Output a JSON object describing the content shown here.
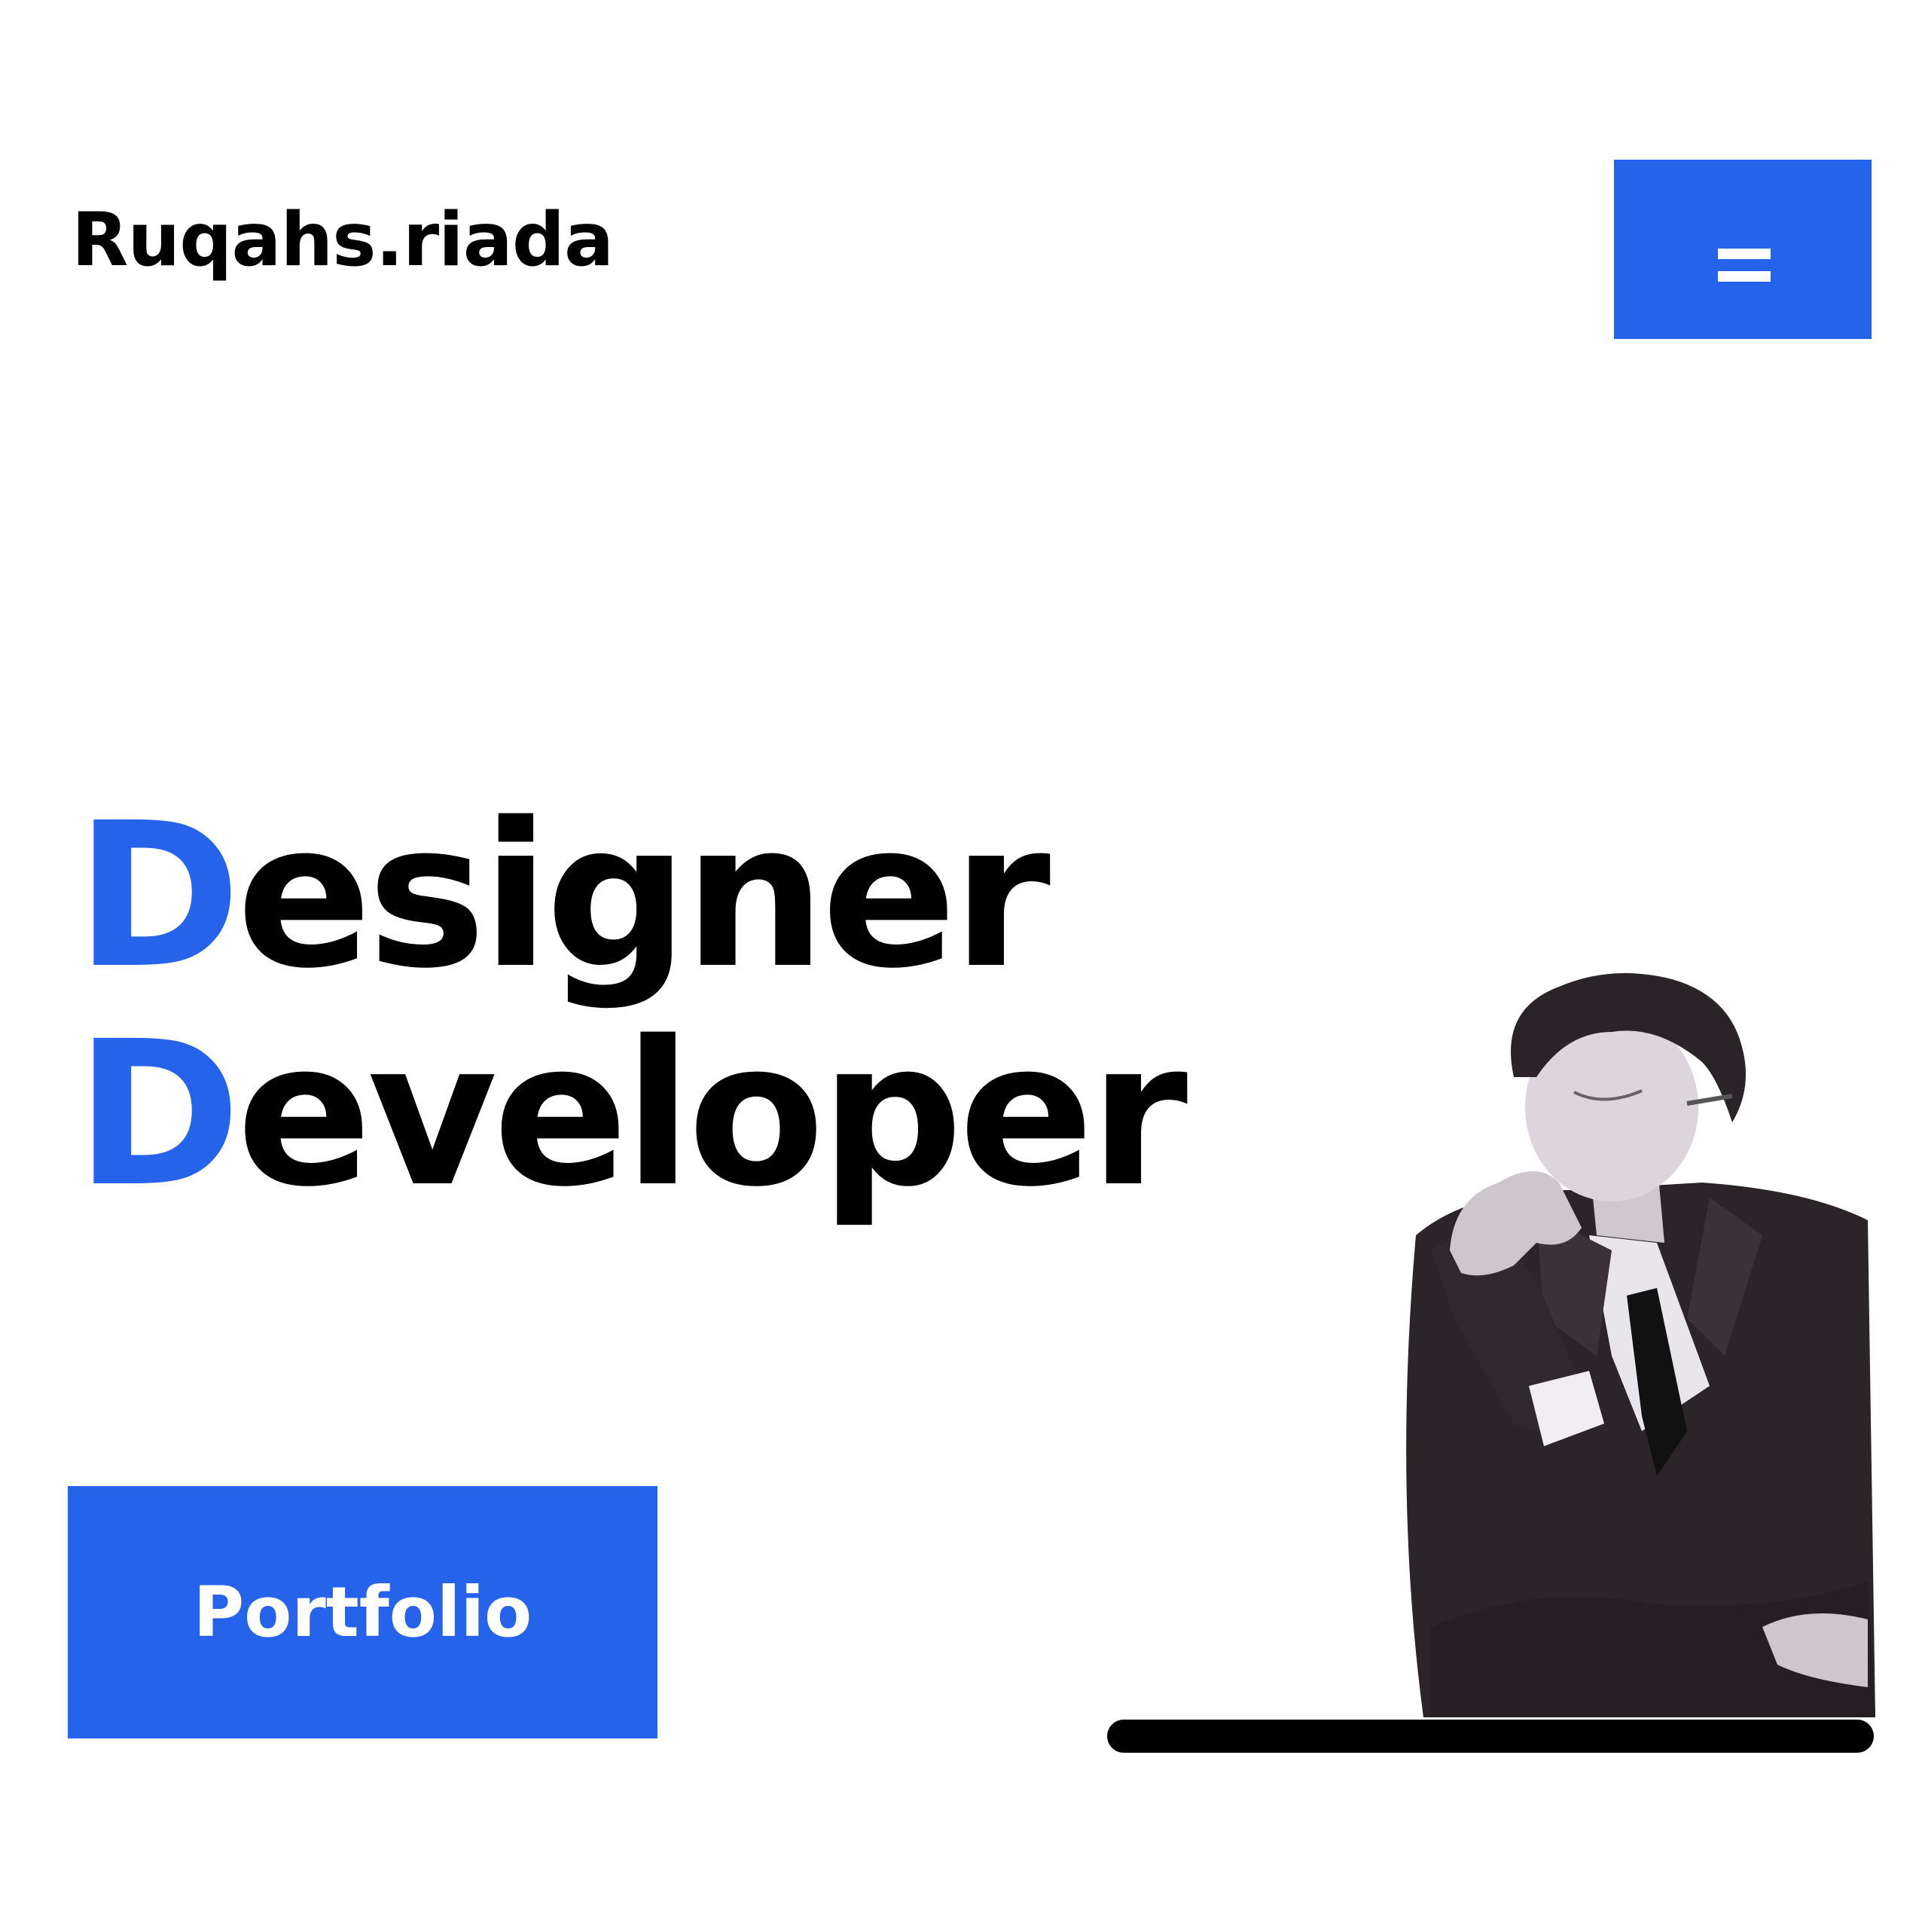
{
  "header": {
    "logo_text": "Ruqahs.riada",
    "menu_icon": "hamburger-menu-icon"
  },
  "hero": {
    "line1_initial": "D",
    "line1_rest": "esigner",
    "line2_initial": "D",
    "line2_rest": "eveloper",
    "portfolio_label": "Portfolio",
    "illustration": "thinking-man-in-suit-illustration"
  },
  "colors": {
    "accent": "#2563eb",
    "text": "#000000",
    "background": "#ffffff"
  }
}
